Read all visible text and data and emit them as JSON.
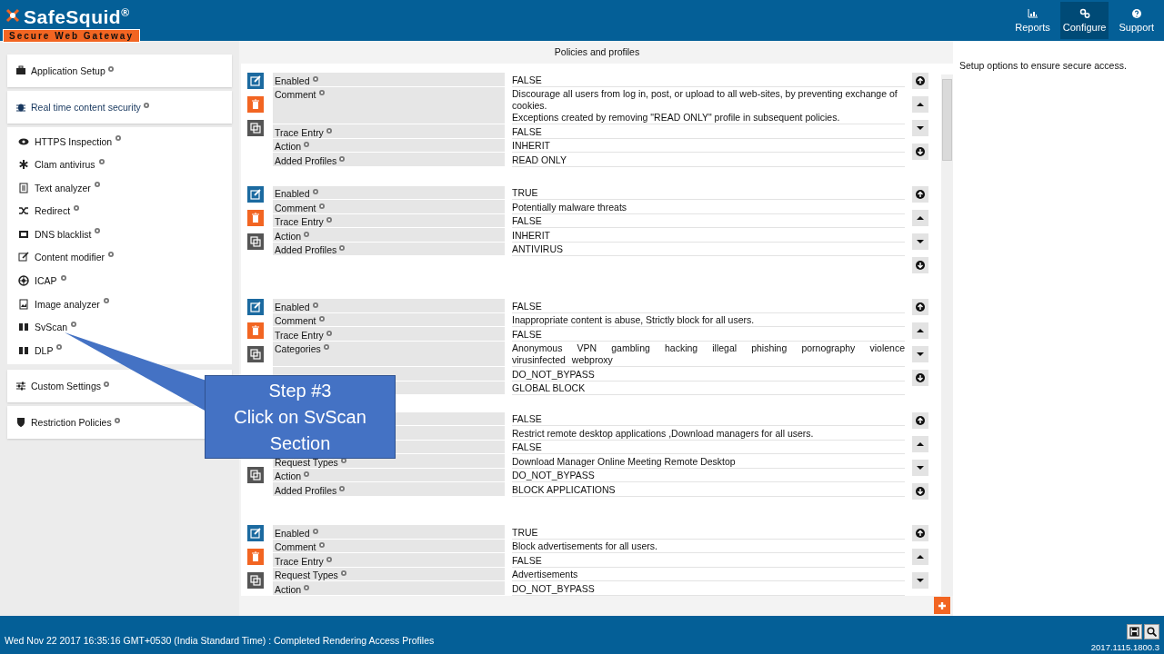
{
  "header": {
    "logo_title": "SafeSquid$^{®}$",
    "logo_tagline": "Secure Web Gateway",
    "nav": [
      {
        "label": "Reports",
        "selected": false
      },
      {
        "label": "Configure",
        "selected": true
      },
      {
        "label": "Support",
        "selected": false
      }
    ]
  },
  "sidebar": {
    "sections": [
      {
        "label": "Application Setup",
        "selected": false
      },
      {
        "label": "Real time content security",
        "selected": true,
        "children": [
          {
            "label": "HTTPS Inspection"
          },
          {
            "label": "Clam antivirus"
          },
          {
            "label": "Text analyzer"
          },
          {
            "label": "Redirect"
          },
          {
            "label": "DNS blacklist"
          },
          {
            "label": "Content modifier"
          },
          {
            "label": "ICAP"
          },
          {
            "label": "Image analyzer"
          },
          {
            "label": "SvScan"
          },
          {
            "label": "DLP"
          }
        ]
      },
      {
        "label": "Custom Settings",
        "selected": false
      },
      {
        "label": "Restriction Policies",
        "selected": false
      }
    ]
  },
  "main": {
    "title": "Policies and profiles",
    "policies": [
      {
        "actions": [
          {
            "kind": "edit"
          },
          {
            "kind": "delete"
          },
          {
            "kind": "copy"
          }
        ],
        "moves": [
          {
            "kind": "top"
          },
          {
            "kind": "up"
          },
          {
            "kind": "down"
          },
          {
            "kind": "bottom"
          }
        ],
        "rows": [
          {
            "label": "Enabled",
            "value": "FALSE"
          },
          {
            "label": "Comment",
            "value": "Discourage all users from log in, post, or upload to all web-sites, by preventing exchange of cookies.\nExceptions created by removing \"READ ONLY\" profile in subsequent policies."
          },
          {
            "label": "Trace Entry",
            "value": "FALSE"
          },
          {
            "label": "Action",
            "value": "INHERIT"
          },
          {
            "label": "Added Profiles",
            "value": "READ ONLY"
          }
        ]
      },
      {
        "actions": [
          {
            "kind": "edit"
          },
          {
            "kind": "delete"
          },
          {
            "kind": "copy"
          }
        ],
        "moves": [
          {
            "kind": "top"
          },
          {
            "kind": "up"
          },
          {
            "kind": "down"
          },
          {
            "kind": "bottom"
          }
        ],
        "rows": [
          {
            "label": "Enabled",
            "value": "TRUE"
          },
          {
            "label": "Comment",
            "value": "Potentially malware threats"
          },
          {
            "label": "Trace Entry",
            "value": "FALSE"
          },
          {
            "label": "Action",
            "value": "INHERIT"
          },
          {
            "label": "Added Profiles",
            "value": "ANTIVIRUS"
          }
        ]
      },
      {
        "actions": [
          {
            "kind": "edit"
          },
          {
            "kind": "delete"
          },
          {
            "kind": "copy"
          }
        ],
        "moves": [
          {
            "kind": "top"
          },
          {
            "kind": "up"
          },
          {
            "kind": "down"
          },
          {
            "kind": "bottom"
          }
        ],
        "rows": [
          {
            "label": "Enabled",
            "value": "FALSE"
          },
          {
            "label": "Comment",
            "value": "Inappropriate content is abuse, Strictly block for all users."
          },
          {
            "label": "Trace Entry",
            "value": "FALSE"
          },
          {
            "label": "Categories",
            "value": "Anonymous VPN  gambling  hacking  illegal  phishing  pornography  violence  virusinfected webproxy",
            "kind": "list"
          },
          {
            "value": "DO_NOT_BYPASS"
          },
          {
            "value": "GLOBAL BLOCK"
          }
        ]
      },
      {
        "actions": [
          {
            "kind": "covered"
          },
          {
            "kind": "covered"
          },
          {
            "kind": "copy"
          }
        ],
        "moves": [
          {
            "kind": "top"
          },
          {
            "kind": "up"
          },
          {
            "kind": "down"
          },
          {
            "kind": "bottom"
          }
        ],
        "rows": [
          {
            "value": "FALSE"
          },
          {
            "value": "Restrict remote desktop applications ,Download managers for all users."
          },
          {
            "value": "FALSE"
          },
          {
            "label": "Request Types",
            "value": "Download Manager  Online Meeting  Remote Desktop"
          },
          {
            "label": "Action",
            "value": "DO_NOT_BYPASS"
          },
          {
            "label": "Added Profiles",
            "value": "BLOCK APPLICATIONS"
          }
        ]
      },
      {
        "actions": [
          {
            "kind": "edit"
          },
          {
            "kind": "delete"
          },
          {
            "kind": "copy"
          }
        ],
        "moves": [
          {
            "kind": "top"
          },
          {
            "kind": "up"
          },
          {
            "kind": "down"
          }
        ],
        "rows": [
          {
            "label": "Enabled",
            "value": "TRUE"
          },
          {
            "label": "Comment",
            "value": "Block advertisements for all users."
          },
          {
            "label": "Trace Entry",
            "value": "FALSE"
          },
          {
            "label": "Request Types",
            "value": "Advertisements"
          },
          {
            "label": "Action",
            "value": "DO_NOT_BYPASS"
          }
        ]
      }
    ]
  },
  "help_text": "Setup options to ensure secure access.",
  "callout": {
    "lines": [
      "Step #3",
      "Click on SvScan",
      "Section"
    ]
  },
  "status_bar": {
    "message": "Wed Nov 22 2017 16:35:16 GMT+0530 (India Standard Time) : Completed Rendering Access Profiles",
    "version": "2017.1115.1800.3"
  }
}
